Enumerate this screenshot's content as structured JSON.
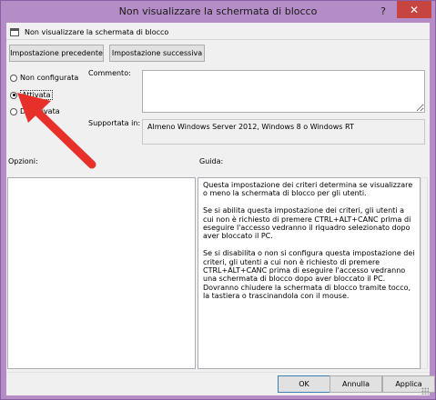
{
  "window": {
    "title": "Non visualizzare la schermata di blocco",
    "help_glyph": "?",
    "close_glyph": "✕"
  },
  "header": {
    "policy_name": "Non visualizzare la schermata di blocco"
  },
  "nav": {
    "prev_label": "Impostazione precedente",
    "next_label": "Impostazione successiva"
  },
  "state": {
    "options": [
      {
        "label": "Non configurata",
        "checked": false
      },
      {
        "label": "Attivata",
        "checked": true
      },
      {
        "label": "Disattivata",
        "checked": false
      }
    ]
  },
  "fields": {
    "comment_label": "Commento:",
    "comment_value": "",
    "supported_label": "Supportata in:",
    "supported_value": "Almeno Windows Server 2012, Windows 8 o Windows RT"
  },
  "panes": {
    "options_label": "Opzioni:",
    "help_label": "Guida:",
    "help_paragraphs": [
      "Questa impostazione dei criteri determina se visualizzare o meno la schermata di blocco per gli utenti.",
      "Se si abilita questa impostazione dei criteri, gli utenti a cui non è richiesto di premere CTRL+ALT+CANC prima di eseguire l'accesso vedranno il riquadro selezionato dopo aver bloccato il PC.",
      "Se si disabilita o non si configura questa impostazione dei criteri, gli utenti a cui non è richiesto di premere CTRL+ALT+CANC prima di eseguire l'accesso vedranno una schermata di blocco dopo aver bloccato il PC. Dovranno chiudere la schermata di blocco tramite tocco, la tastiera o trascinandola con il mouse."
    ]
  },
  "buttons": {
    "ok": "OK",
    "cancel": "Annulla",
    "apply": "Applica"
  },
  "colors": {
    "titlebar": "#b48cc6",
    "close": "#c74540",
    "arrow": "#e8302a"
  },
  "icons": {
    "policy": "policy-setting-icon",
    "annotation": "red-arrow-annotation"
  }
}
